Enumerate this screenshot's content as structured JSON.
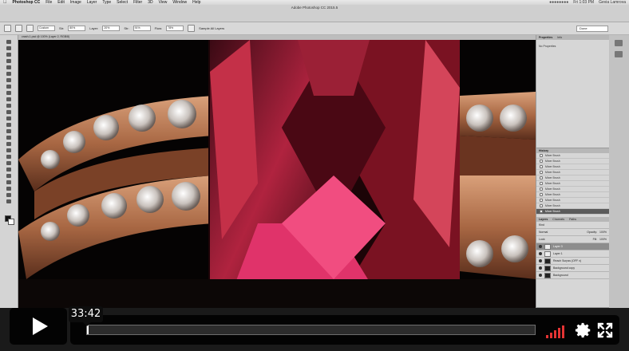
{
  "menubar": {
    "app": "Photoshop CC",
    "items": [
      "File",
      "Edit",
      "Image",
      "Layer",
      "Type",
      "Select",
      "Filter",
      "3D",
      "View",
      "Window",
      "Help"
    ],
    "clock": "Fri 1:03 PM",
    "user": "Gevia Lamrova"
  },
  "app_title": "Adobe Photoshop CC 2015.5",
  "doc_tab": "crash-1.psd @ 100% (Layer 2, RGB/8)",
  "options": {
    "mode": "Custom",
    "fields": [
      {
        "label": "Str:",
        "value": "80%"
      },
      {
        "label": "Layer:",
        "value": "20%"
      },
      {
        "label": "Str:",
        "value": "91%"
      },
      {
        "label": "Flow:",
        "value": "78%"
      }
    ],
    "sample": "Sample All Layers",
    "workspace": "Done"
  },
  "panels": {
    "properties_tab": "Properties",
    "info_tab": "Info",
    "no_properties": "No Properties",
    "history_title": "History",
    "history_items": [
      "Mixer Brush",
      "Mixer Brush",
      "Mixer Brush",
      "Mixer Brush",
      "Mixer Brush",
      "Mixer Brush",
      "Mixer Brush",
      "Mixer Brush",
      "Mixer Brush",
      "Mixer Brush",
      "Mixer Brush"
    ],
    "layers_tabs": [
      "Layers",
      "Channels",
      "Paths"
    ],
    "kind": "Kind",
    "blend": "Normal",
    "opacity_label": "Opacity:",
    "opacity": "100%",
    "fill_label": "Fill:",
    "fill": "100%",
    "lock": "Lock:",
    "layers": [
      {
        "name": "Layer 3",
        "selected": true
      },
      {
        "name": "Layer 1",
        "selected": false
      },
      {
        "name": "Reach Surpss (OFF x)",
        "selected": false
      },
      {
        "name": "Background copy",
        "selected": false
      },
      {
        "name": "Background",
        "selected": false
      }
    ]
  },
  "player": {
    "time": "33:42",
    "progress": 0.0,
    "buffered": 0.0,
    "volume_bars": [
      4,
      7,
      10,
      13,
      16
    ],
    "accent": "#e33333"
  }
}
